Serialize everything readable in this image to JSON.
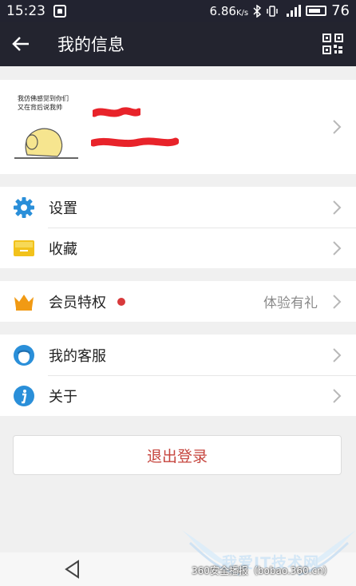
{
  "status_bar": {
    "time": "15:23",
    "speed": "6.86",
    "speed_unit": "K/s",
    "battery": "76"
  },
  "header": {
    "title": "我的信息"
  },
  "profile": {
    "avatar_text_line1": "我仿佛感觉到你们",
    "avatar_text_line2": "又在背后说我帅"
  },
  "menu": {
    "settings": "设置",
    "favorites": "收藏",
    "vip": "会员特权",
    "vip_extra": "体验有礼",
    "service": "我的客服",
    "about": "关于"
  },
  "logout_label": "退出登录",
  "watermark": {
    "brand": "我爱IT技术网",
    "source": "360安全播报（bobao.360.cn）"
  },
  "colors": {
    "header_bg": "#23242f",
    "settings_icon": "#2a8fd9",
    "favorites_icon": "#f2c21b",
    "vip_icon": "#f19a14",
    "service_icon": "#2a8fd9",
    "about_icon": "#2a8fd9",
    "logout_text": "#c6453e",
    "redaction": "#e8232a"
  }
}
